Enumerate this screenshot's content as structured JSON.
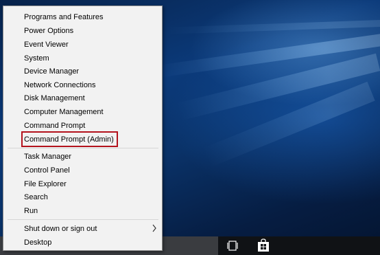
{
  "context_menu": {
    "groups": [
      {
        "items": [
          {
            "label": "Programs and Features"
          },
          {
            "label": "Power Options"
          },
          {
            "label": "Event Viewer"
          },
          {
            "label": "System"
          },
          {
            "label": "Device Manager"
          },
          {
            "label": "Network Connections"
          },
          {
            "label": "Disk Management"
          },
          {
            "label": "Computer Management"
          },
          {
            "label": "Command Prompt"
          },
          {
            "label": "Command Prompt (Admin)",
            "highlighted": true
          }
        ]
      },
      {
        "items": [
          {
            "label": "Task Manager"
          },
          {
            "label": "Control Panel"
          },
          {
            "label": "File Explorer"
          },
          {
            "label": "Search"
          },
          {
            "label": "Run"
          }
        ]
      },
      {
        "items": [
          {
            "label": "Shut down or sign out",
            "submenu": true
          },
          {
            "label": "Desktop"
          }
        ]
      }
    ],
    "highlight_color": "#b3121c"
  },
  "taskbar": {
    "icons": [
      "task-view-icon",
      "store-icon"
    ]
  },
  "colors": {
    "menu_background": "#f2f2f2",
    "taskbar": "#101215",
    "desktop_accent": "#0b3a7a"
  }
}
